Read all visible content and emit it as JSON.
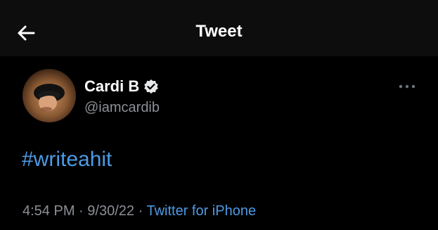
{
  "header": {
    "title": "Tweet",
    "back_icon": "arrow-left-icon"
  },
  "tweet": {
    "author": {
      "display_name": "Cardi B",
      "handle": "@iamcardib",
      "verified": true,
      "verified_icon": "verified-badge-icon"
    },
    "more_icon": "more-options-icon",
    "text": "#writeahit",
    "meta": {
      "time": "4:54 PM",
      "separator": "·",
      "date": "9/30/22",
      "source": "Twitter for iPhone"
    }
  },
  "colors": {
    "background": "#000000",
    "header_background": "#0d0d0d",
    "primary_text": "#ffffff",
    "secondary_text": "#8b8f95",
    "link": "#4d9ae4"
  }
}
